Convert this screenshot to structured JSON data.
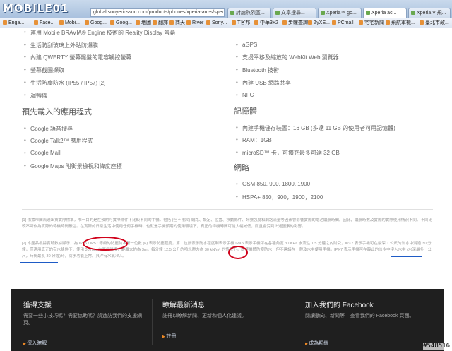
{
  "browser": {
    "logo": "MOBILE01",
    "url": "global.sonyericsson.com/products/phones/xperia-arc-s/specifications",
    "tabs": [
      {
        "label": "討論熱烈區..."
      },
      {
        "label": "文章搜尋..."
      },
      {
        "label": "Xperia™ go..."
      },
      {
        "label": "Xperia ac..."
      },
      {
        "label": "Xperia V 規..."
      }
    ],
    "bookmarks": [
      {
        "label": "Enga..."
      },
      {
        "label": "Face..."
      },
      {
        "label": "Mobi..."
      },
      {
        "label": "Goog..."
      },
      {
        "label": "Goog..."
      },
      {
        "label": "地圖"
      },
      {
        "label": "翻譯"
      },
      {
        "label": "商天"
      },
      {
        "label": "River"
      },
      {
        "label": "Sony..."
      },
      {
        "label": "T客邦"
      },
      {
        "label": "中華3+2"
      },
      {
        "label": "步驟查詢"
      },
      {
        "label": "ZyXE..."
      },
      {
        "label": "PCmall"
      },
      {
        "label": "宅宅新聞"
      },
      {
        "label": "飛航軍機..."
      },
      {
        "label": "臺北市政..."
      }
    ]
  },
  "left_col": {
    "top_items": [
      "運用 Mobile BRAVIA® Engine 技術的 Reality Display 螢幕",
      "生活防刮玻璃上外貼防爆膜",
      "內建 QWERTY 螢幕鍵盤的電容觸控螢幕",
      "螢幕截圖擷取",
      "生活防塵防水 (IP55 / IP57) [2]",
      "迴轉儀"
    ],
    "preloaded_heading": "預先載入的應用程式",
    "preloaded_items": [
      "Google 語音搜尋",
      "Google Talk2™ 應用程式",
      "Google Mail",
      "Google Maps 附街景檢視和緯度座標"
    ]
  },
  "right_col": {
    "top_items": [
      "aGPS",
      "支援平移及縮放的 WebKit Web 瀏覽器",
      "Bluetooth 技術",
      "內建 USB 網路共享",
      "NFC"
    ],
    "memory_heading": "記憶體",
    "memory_items": [
      "內建手機儲存裝置：16 GB (多達 11 GB 的使用者可用記憶體)",
      "RAM：1GB",
      "microSD™ 卡，可擴充最多可達 32 GB"
    ],
    "network_heading": "網路",
    "network_items": [
      "GSM 850, 900, 1800, 1900",
      "HSPA+ 850，900，1900，2100"
    ]
  },
  "notes": {
    "note1": "[1] 依據市間流通出貨實際標準，唯一目的是在預期可實際條件下比較不同的手機。包括 (但不限於) 網路、設定、位置、移動條件、訊號強度和網路流量等因素會影響實際的電池續航時間。因此，續航時數及實際的實際使用情況不同。不同比較不可作為實際的待機時間預估。在實際的日常生活中使用任何手機時，也就是手機預期的使用環境下，真正的待機時間可能大幅減低，而且會受到上述因素的影響。",
    "note2": "[2] 本產品根據實驗數據顯示，為 IP65 / IP57 等級的防塵防水第一位數 (6) 表示防塵程度，第二位數表示防水程度則表示手機 IPX5 表示手機可在各種角度 30 KPa 水流在 1.5 分鐘之內耐受，IPX7 表示手機可在最深 1 公尺的淡水中浸泡 30 分鐘，僅適用真正的有水條件下，使用 30 mm 內面徑噴嘴，距離大約為 3m，每分鐘 12.5 公升的噴水壓力為 30 kN/m² 的情況下。即使機體防塵防水，但不建議在一般及水中使用手機。IPX7 表示手機可在靜止的淡水中沒入水中 (水深最多一公尺，時間最長 30 分鐘)時，防水功能正常。具沖有水氣滲入。"
  },
  "footer": {
    "support_title": "獲得支援",
    "support_text": "需要一些小技巧嗎？需要協助嗎？請造訪我們的支援網頁。",
    "support_link": "深入瞭解",
    "news_title": "瞭解最新消息",
    "news_text": "註冊以瞭解新聞、更新和個人化建議。",
    "news_link": "註冊",
    "fb_title": "加入我們的 Facebook",
    "fb_text": "閱讀動向、新聞等 – 查看我們的 Facebook 頁面。",
    "fb_link": "成為粉絲"
  },
  "watermark": "#548516"
}
